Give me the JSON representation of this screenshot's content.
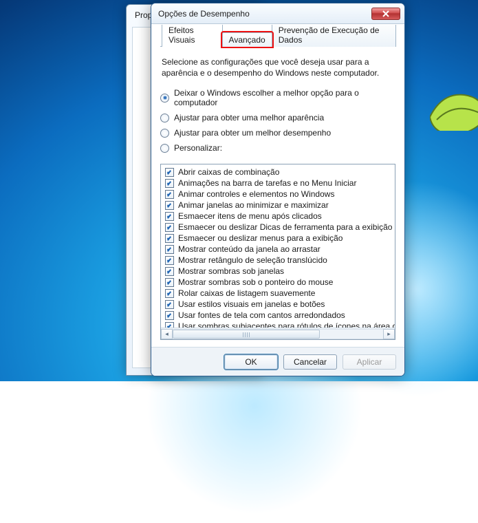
{
  "backWindow": {
    "title": "Prop"
  },
  "dialog": {
    "title": "Opções de Desempenho",
    "tabs": [
      {
        "label": "Efeitos Visuais",
        "active": true
      },
      {
        "label": "Avançado",
        "highlighted": true
      },
      {
        "label": "Prevenção de Execução de Dados"
      }
    ],
    "description": "Selecione as configurações que você deseja usar para a aparência e o desempenho do Windows neste computador.",
    "radios": [
      {
        "label": "Deixar o Windows escolher a melhor opção para o computador",
        "checked": true
      },
      {
        "label": "Ajustar para obter uma melhor aparência"
      },
      {
        "label": "Ajustar para obter um melhor desempenho"
      },
      {
        "label": "Personalizar:"
      }
    ],
    "items": [
      "Abrir caixas de combinação",
      "Animações na barra de tarefas e no Menu Iniciar",
      "Animar controles e elementos no Windows",
      "Animar janelas ao minimizar e maximizar",
      "Esmaecer itens de menu após clicados",
      "Esmaecer ou deslizar Dicas de ferramenta para a exibição",
      "Esmaecer ou deslizar menus para a exibição",
      "Mostrar conteúdo da janela ao arrastar",
      "Mostrar retângulo de seleção translúcido",
      "Mostrar sombras sob janelas",
      "Mostrar sombras sob o ponteiro do mouse",
      "Rolar caixas de listagem suavemente",
      "Usar estilos visuais em janelas e botões",
      "Usar fontes de tela com cantos arredondados",
      "Usar sombras subjacentes para rótulos de ícones na área de t"
    ],
    "buttons": {
      "ok": "OK",
      "cancel": "Cancelar",
      "apply": "Aplicar"
    }
  }
}
